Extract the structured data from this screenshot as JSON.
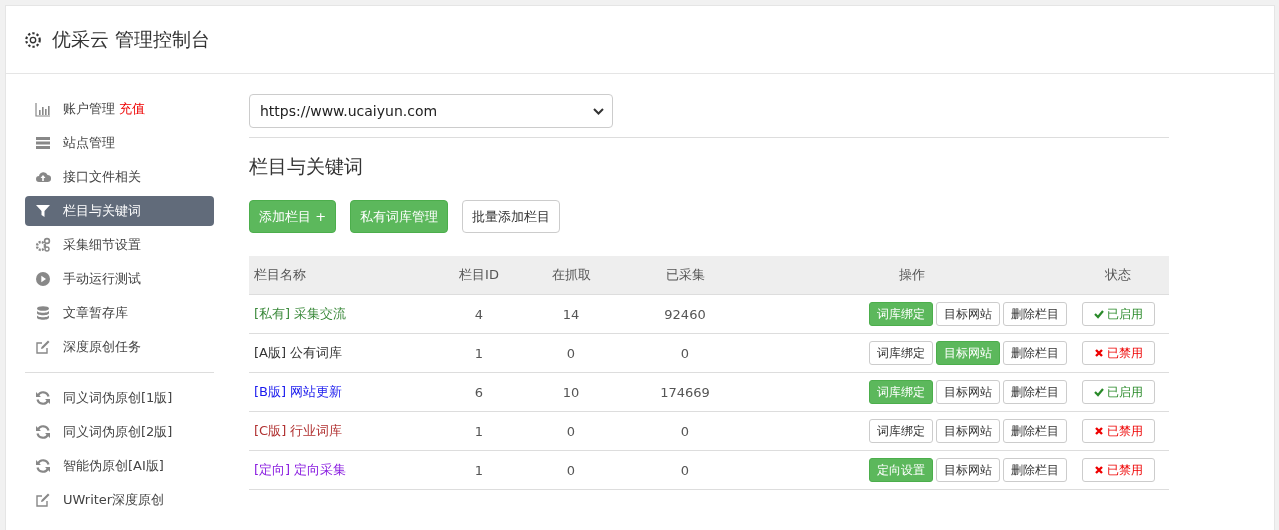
{
  "header": {
    "title": "优采云 管理控制台"
  },
  "sidebar": {
    "groups": [
      {
        "items": [
          {
            "label": "账户管理",
            "badge": "充值",
            "selected": false
          },
          {
            "label": "站点管理",
            "selected": false
          },
          {
            "label": "接口文件相关",
            "selected": false
          },
          {
            "label": "栏目与关键词",
            "selected": true
          },
          {
            "label": "采集细节设置",
            "selected": false
          },
          {
            "label": "手动运行测试",
            "selected": false
          },
          {
            "label": "文章暂存库",
            "selected": false
          },
          {
            "label": "深度原创任务",
            "selected": false
          }
        ]
      },
      {
        "items": [
          {
            "label": "同义词伪原创[1版]",
            "selected": false
          },
          {
            "label": "同义词伪原创[2版]",
            "selected": false
          },
          {
            "label": "智能伪原创[AI版]",
            "selected": false
          },
          {
            "label": "UWriter深度原创",
            "selected": false
          }
        ]
      }
    ]
  },
  "site_select": {
    "value": "https://www.ucaiyun.com"
  },
  "section_title": "栏目与关键词",
  "toolbar": [
    {
      "label": "添加栏目 +",
      "primary": true
    },
    {
      "label": "私有词库管理",
      "primary": true
    },
    {
      "label": "批量添加栏目",
      "primary": false
    }
  ],
  "table": {
    "columns": [
      "栏目名称",
      "栏目ID",
      "在抓取",
      "已采集",
      "操作",
      "状态"
    ],
    "rows": [
      {
        "tag": "[私有]",
        "name": "采集交流",
        "color": "#3c8a3c",
        "id": "4",
        "fetching": "14",
        "collected": "92460",
        "actions": [
          {
            "label": "词库绑定",
            "active": true
          },
          {
            "label": "目标网站",
            "active": false
          },
          {
            "label": "删除栏目",
            "active": false
          }
        ],
        "status": {
          "label": "已启用",
          "enabled": true
        }
      },
      {
        "tag": "[A版]",
        "name": "公有词库",
        "color": "#333333",
        "id": "1",
        "fetching": "0",
        "collected": "0",
        "actions": [
          {
            "label": "词库绑定",
            "active": false
          },
          {
            "label": "目标网站",
            "active": true
          },
          {
            "label": "删除栏目",
            "active": false
          }
        ],
        "status": {
          "label": "已禁用",
          "enabled": false
        }
      },
      {
        "tag": "[B版]",
        "name": "网站更新",
        "color": "#1a1aee",
        "id": "6",
        "fetching": "10",
        "collected": "174669",
        "actions": [
          {
            "label": "词库绑定",
            "active": true
          },
          {
            "label": "目标网站",
            "active": false
          },
          {
            "label": "删除栏目",
            "active": false
          }
        ],
        "status": {
          "label": "已启用",
          "enabled": true
        }
      },
      {
        "tag": "[C版]",
        "name": "行业词库",
        "color": "#b03030",
        "id": "1",
        "fetching": "0",
        "collected": "0",
        "actions": [
          {
            "label": "词库绑定",
            "active": false
          },
          {
            "label": "目标网站",
            "active": false
          },
          {
            "label": "删除栏目",
            "active": false
          }
        ],
        "status": {
          "label": "已禁用",
          "enabled": false
        }
      },
      {
        "tag": "[定向]",
        "name": "定向采集",
        "color": "#8a1ee0",
        "id": "1",
        "fetching": "0",
        "collected": "0",
        "actions": [
          {
            "label": "定向设置",
            "active": true
          },
          {
            "label": "目标网站",
            "active": false
          },
          {
            "label": "删除栏目",
            "active": false
          }
        ],
        "status": {
          "label": "已禁用",
          "enabled": false
        }
      }
    ]
  }
}
